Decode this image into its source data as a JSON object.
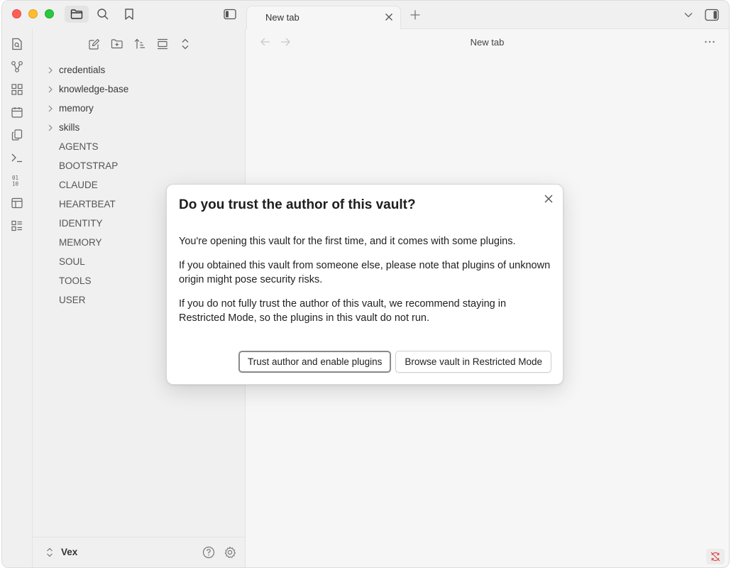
{
  "window": {
    "traffic_lights": [
      "close",
      "minimize",
      "zoom"
    ]
  },
  "sidebar_top": {
    "icons": [
      "folder-icon",
      "search-icon",
      "bookmark-icon",
      "sidebar-toggle-icon"
    ]
  },
  "ribbon": {
    "icons": [
      "quick-switcher-icon",
      "graph-icon",
      "canvas-icon",
      "calendar-icon",
      "copy-icon",
      "terminal-icon",
      "binary-icon",
      "template-icon",
      "list-icon"
    ]
  },
  "explorer": {
    "actions": [
      "new-note-icon",
      "new-folder-icon",
      "sort-icon",
      "collapse-icon",
      "expand-icon"
    ],
    "folders": [
      "credentials",
      "knowledge-base",
      "memory",
      "skills"
    ],
    "files": [
      "AGENTS",
      "BOOTSTRAP",
      "CLAUDE",
      "HEARTBEAT",
      "IDENTITY",
      "MEMORY",
      "SOUL",
      "TOOLS",
      "USER"
    ]
  },
  "vault": {
    "name": "Vex"
  },
  "tabs": {
    "active_title": "New tab"
  },
  "view": {
    "title": "New tab"
  },
  "modal": {
    "title": "Do you trust the author of this vault?",
    "paragraphs": [
      "You're opening this vault for the first time, and it comes with some plugins.",
      "If you obtained this vault from someone else, please note that plugins of unknown origin might pose security risks.",
      "If you do not fully trust the author of this vault, we recommend staying in Restricted Mode, so the plugins in this vault do not run."
    ],
    "trust_button": "Trust author and enable plugins",
    "restricted_button": "Browse vault in Restricted Mode"
  },
  "colors": {
    "close": "#ff5f57",
    "minimize": "#febc2e",
    "zoom": "#28c840",
    "sync_error": "#e04a4a"
  }
}
